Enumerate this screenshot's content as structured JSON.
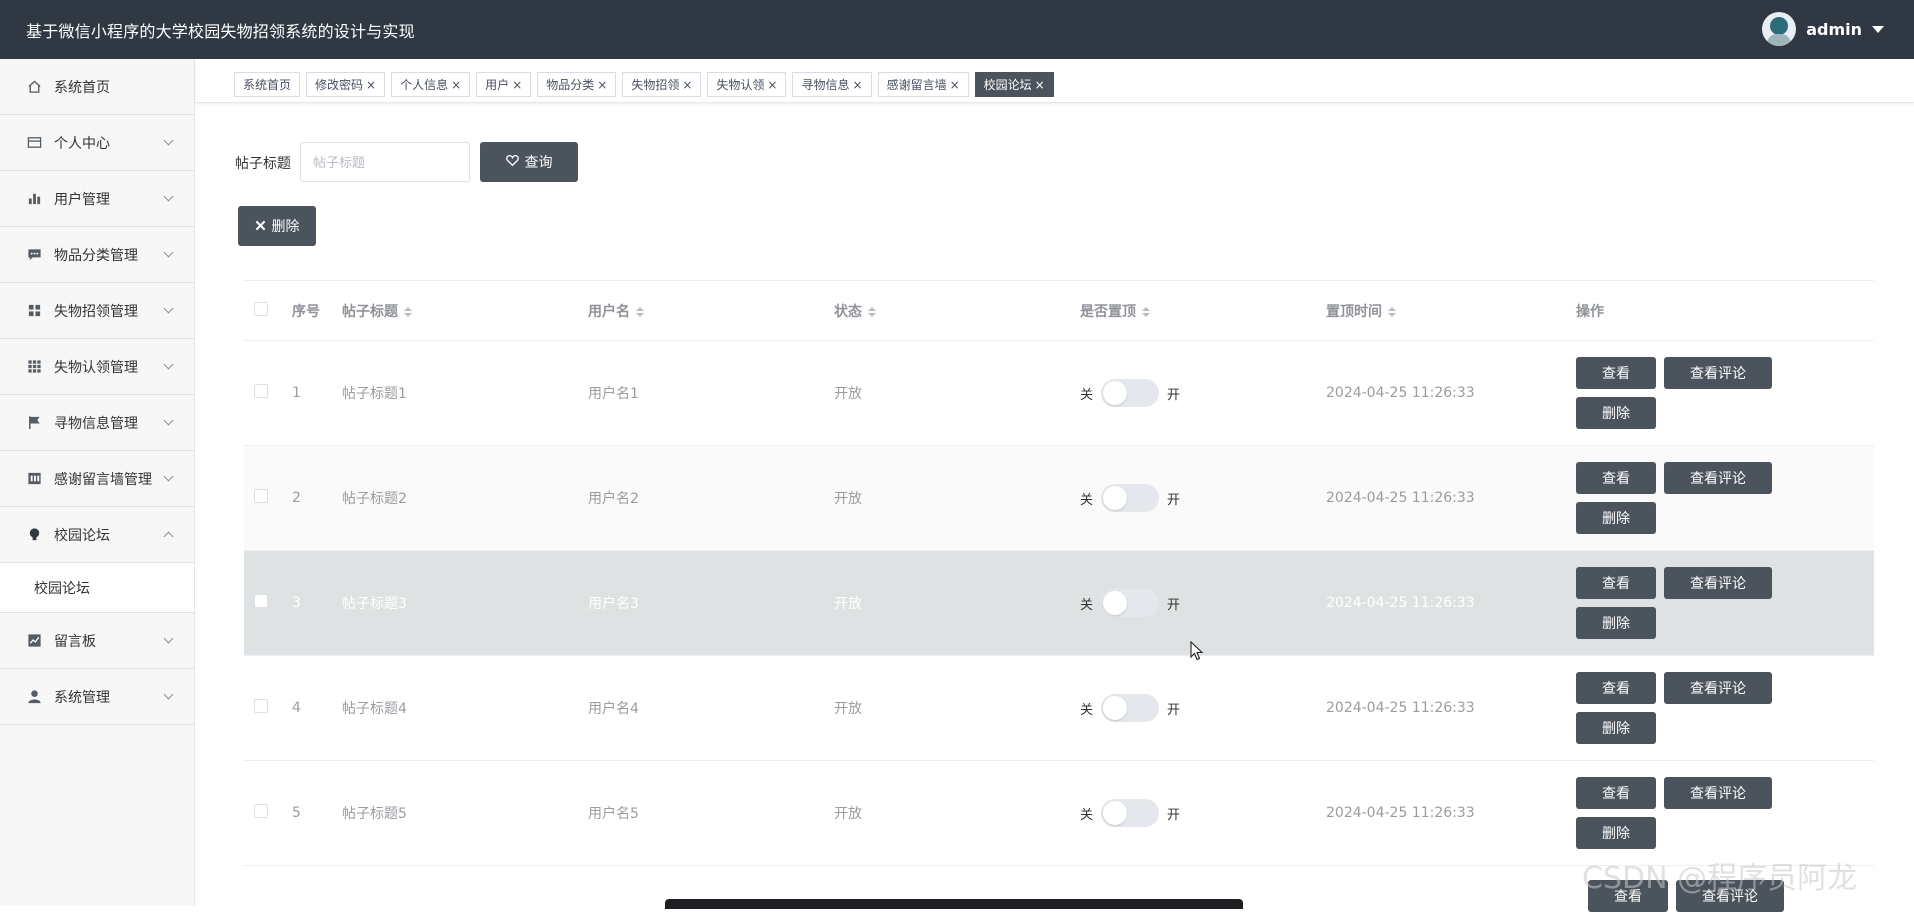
{
  "header": {
    "title": "基于微信小程序的大学校园失物招领系统的设计与实现",
    "user": "admin"
  },
  "sidebar": {
    "items": [
      {
        "label": "系统首页",
        "icon": "home-icon",
        "expanded": null
      },
      {
        "label": "个人中心",
        "icon": "card-icon",
        "expanded": false
      },
      {
        "label": "用户管理",
        "icon": "bar-chart-icon",
        "expanded": false
      },
      {
        "label": "物品分类管理",
        "icon": "chat-icon",
        "expanded": false
      },
      {
        "label": "失物招领管理",
        "icon": "grid-icon",
        "expanded": false
      },
      {
        "label": "失物认领管理",
        "icon": "apps-icon",
        "expanded": false
      },
      {
        "label": "寻物信息管理",
        "icon": "flag-icon",
        "expanded": false
      },
      {
        "label": "感谢留言墙管理",
        "icon": "building-icon",
        "expanded": false
      },
      {
        "label": "校园论坛",
        "icon": "bulb-icon",
        "expanded": true
      },
      {
        "label": "留言板",
        "icon": "trend-icon",
        "expanded": false
      },
      {
        "label": "系统管理",
        "icon": "person-icon",
        "expanded": false
      }
    ],
    "submenu": {
      "label": "校园论坛"
    }
  },
  "tabs": [
    {
      "label": "系统首页",
      "closable": false,
      "active": false
    },
    {
      "label": "修改密码",
      "closable": true,
      "active": false
    },
    {
      "label": "个人信息",
      "closable": true,
      "active": false
    },
    {
      "label": "用户",
      "closable": true,
      "active": false
    },
    {
      "label": "物品分类",
      "closable": true,
      "active": false
    },
    {
      "label": "失物招领",
      "closable": true,
      "active": false
    },
    {
      "label": "失物认领",
      "closable": true,
      "active": false
    },
    {
      "label": "寻物信息",
      "closable": true,
      "active": false
    },
    {
      "label": "感谢留言墙",
      "closable": true,
      "active": false
    },
    {
      "label": "校园论坛",
      "closable": true,
      "active": true
    }
  ],
  "search": {
    "label": "帖子标题",
    "placeholder": "帖子标题",
    "value": "",
    "button": "查询"
  },
  "toolbar": {
    "delete_label": "删除"
  },
  "table": {
    "columns": [
      "序号",
      "帖子标题",
      "用户名",
      "状态",
      "是否置顶",
      "置顶时间",
      "操作"
    ],
    "switch_off": "关",
    "switch_on": "开",
    "actions": {
      "view": "查看",
      "comments": "查看评论",
      "delete": "删除"
    },
    "rows": [
      {
        "no": "1",
        "title": "帖子标题1",
        "user": "用户名1",
        "status": "开放",
        "pinned": false,
        "time": "2024-04-25 11:26:33"
      },
      {
        "no": "2",
        "title": "帖子标题2",
        "user": "用户名2",
        "status": "开放",
        "pinned": false,
        "time": "2024-04-25 11:26:33"
      },
      {
        "no": "3",
        "title": "帖子标题3",
        "user": "用户名3",
        "status": "开放",
        "pinned": false,
        "time": "2024-04-25 11:26:33"
      },
      {
        "no": "4",
        "title": "帖子标题4",
        "user": "用户名4",
        "status": "开放",
        "pinned": false,
        "time": "2024-04-25 11:26:33"
      },
      {
        "no": "5",
        "title": "帖子标题5",
        "user": "用户名5",
        "status": "开放",
        "pinned": false,
        "time": "2024-04-25 11:26:33"
      }
    ]
  },
  "watermark": "CSDN @程序员阿龙",
  "colors": {
    "header_bg": "#2f3843",
    "button_bg": "#4b535d",
    "sidebar_bg": "#f7f7f7"
  }
}
